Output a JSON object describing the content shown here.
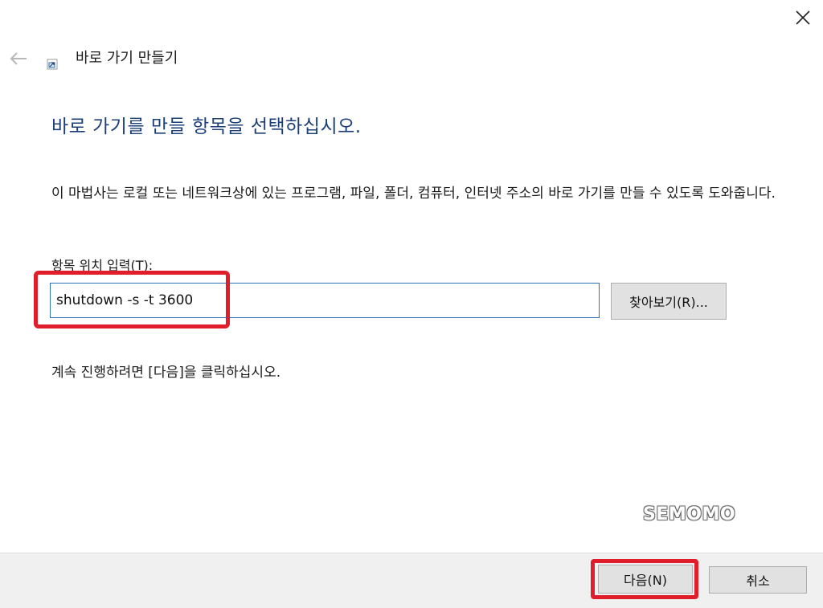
{
  "titlebar": {
    "title": "바로 가기 만들기",
    "close_icon": "close-icon",
    "back_icon": "back-arrow-icon",
    "app_icon": "shortcut-wizard-icon"
  },
  "heading": "바로 가기를 만들 항목을 선택하십시오.",
  "description": "이 마법사는 로컬 또는 네트워크상에 있는 프로그램, 파일, 폴더, 컴퓨터, 인터넷 주소의 바로 가기를 만들 수 있도록 도와줍니다.",
  "location": {
    "label": "항목 위치 입력(T):",
    "value": "shutdown -s -t 3600",
    "browse_label": "찾아보기(R)..."
  },
  "continue_hint": "계속 진행하려면 [다음]을 클릭하십시오.",
  "watermark": "SEMOMO",
  "footer": {
    "next_label": "다음(N)",
    "cancel_label": "취소"
  },
  "colors": {
    "heading": "#1c3f7a",
    "highlight": "#e01e2b",
    "input_border": "#2f6fb7",
    "footer_bg": "#f0f0f0"
  }
}
